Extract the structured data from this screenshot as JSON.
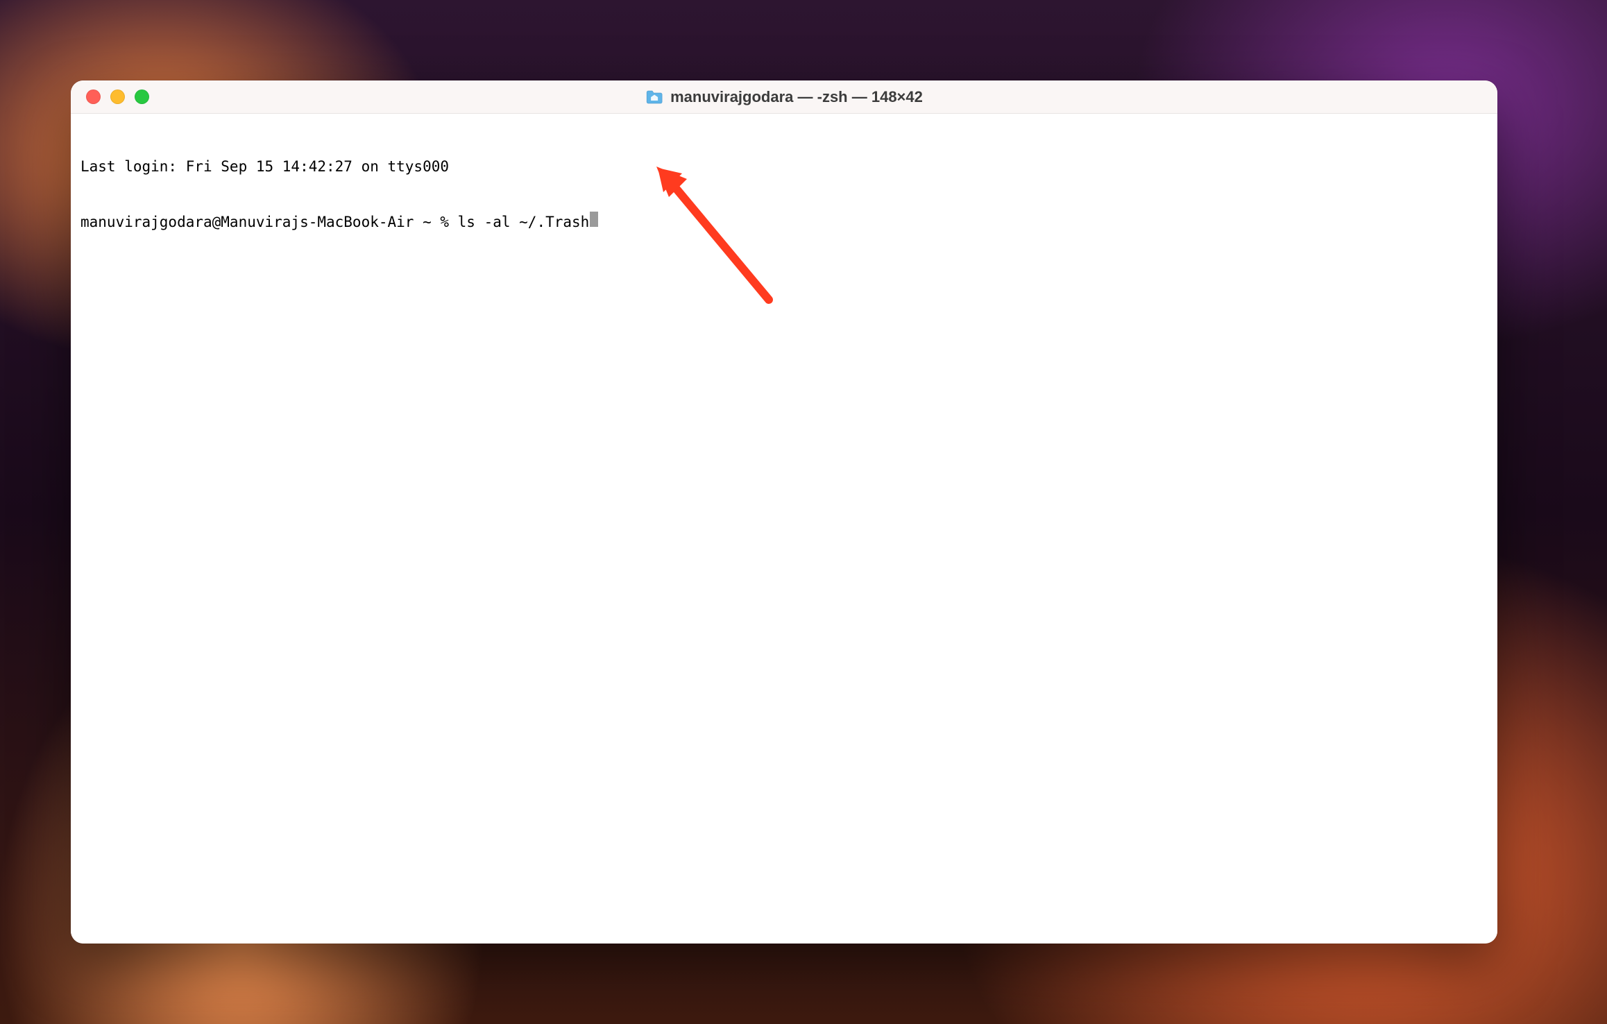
{
  "window": {
    "title": "manuvirajgodara — -zsh — 148×42"
  },
  "terminal": {
    "last_login_line": "Last login: Fri Sep 15 14:42:27 on ttys000",
    "prompt": "manuvirajgodara@Manuvirajs-MacBook-Air ~ % ",
    "command": "ls -al ~/.Trash"
  }
}
